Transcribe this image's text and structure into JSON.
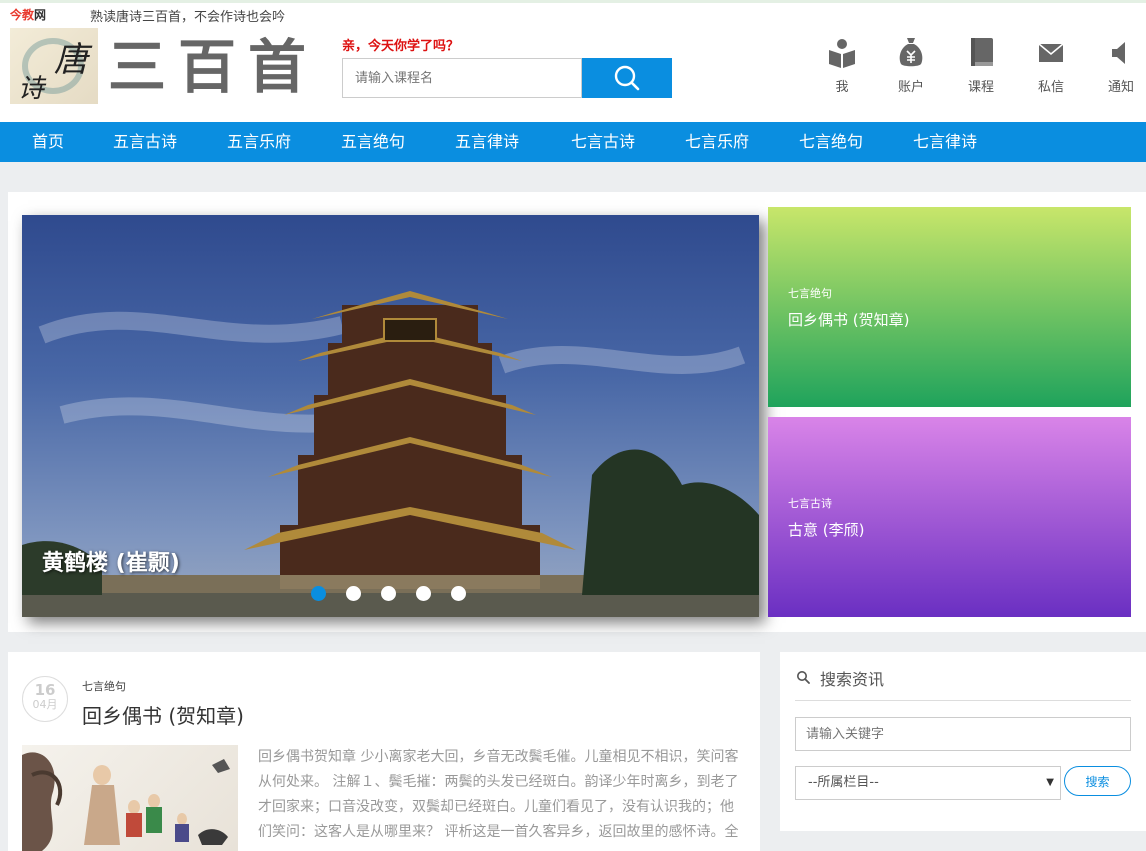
{
  "topbar": {
    "logo_brand_mark": "今教",
    "logo_brand_suffix": "网",
    "tagline": "熟读唐诗三百首，不会作诗也会吟"
  },
  "header": {
    "logo_char_1": "唐",
    "logo_char_2": "诗",
    "site_title": "三百首",
    "slogan": "亲，今天你学了吗？",
    "search_placeholder": "请输入课程名",
    "icons": [
      {
        "label": "我",
        "icon": "user-book-icon"
      },
      {
        "label": "账户",
        "icon": "money-bag-icon"
      },
      {
        "label": "课程",
        "icon": "book-icon"
      },
      {
        "label": "私信",
        "icon": "envelope-icon"
      },
      {
        "label": "通知",
        "icon": "speaker-icon"
      }
    ]
  },
  "nav": {
    "items": [
      "首页",
      "五言古诗",
      "五言乐府",
      "五言绝句",
      "五言律诗",
      "七言古诗",
      "七言乐府",
      "七言绝句",
      "七言律诗"
    ]
  },
  "slider": {
    "caption": "黄鹤楼 (崔颢)",
    "dot_count": 5,
    "active_dot": 1
  },
  "cards": [
    {
      "category": "七言绝句",
      "title": "回乡偶书 (贺知章)",
      "gradient": [
        "#c8e66a",
        "#1fa35c"
      ]
    },
    {
      "category": "七言古诗",
      "title": "古意 (李颀)",
      "gradient": [
        "#d984e8",
        "#6a2fc2"
      ]
    }
  ],
  "article": {
    "day": "16",
    "month": "04月",
    "category": "七言绝句",
    "title": "回乡偶书 (贺知章)",
    "excerpt": "回乡偶书贺知章 少小离家老大回，乡音无改鬓毛催。儿童相见不相识，笑问客从何处来。 注解１、鬓毛摧：两鬓的头发已经斑白。韵译少年时离乡，到老了才回家来；口音没改变，双鬓却已经斑白。儿童们看见了，没有认识我的；他们笑问：这客人是从哪里来？ 评析这是一首久客异乡，返回故里的感怀诗。全"
  },
  "sidebar": {
    "title": "搜索资讯",
    "keyword_placeholder": "请输入关键字",
    "category_select": "--所属栏目--",
    "search_button": "搜索"
  },
  "colors": {
    "accent": "#0a8ee0",
    "slogan": "#dd1111"
  }
}
